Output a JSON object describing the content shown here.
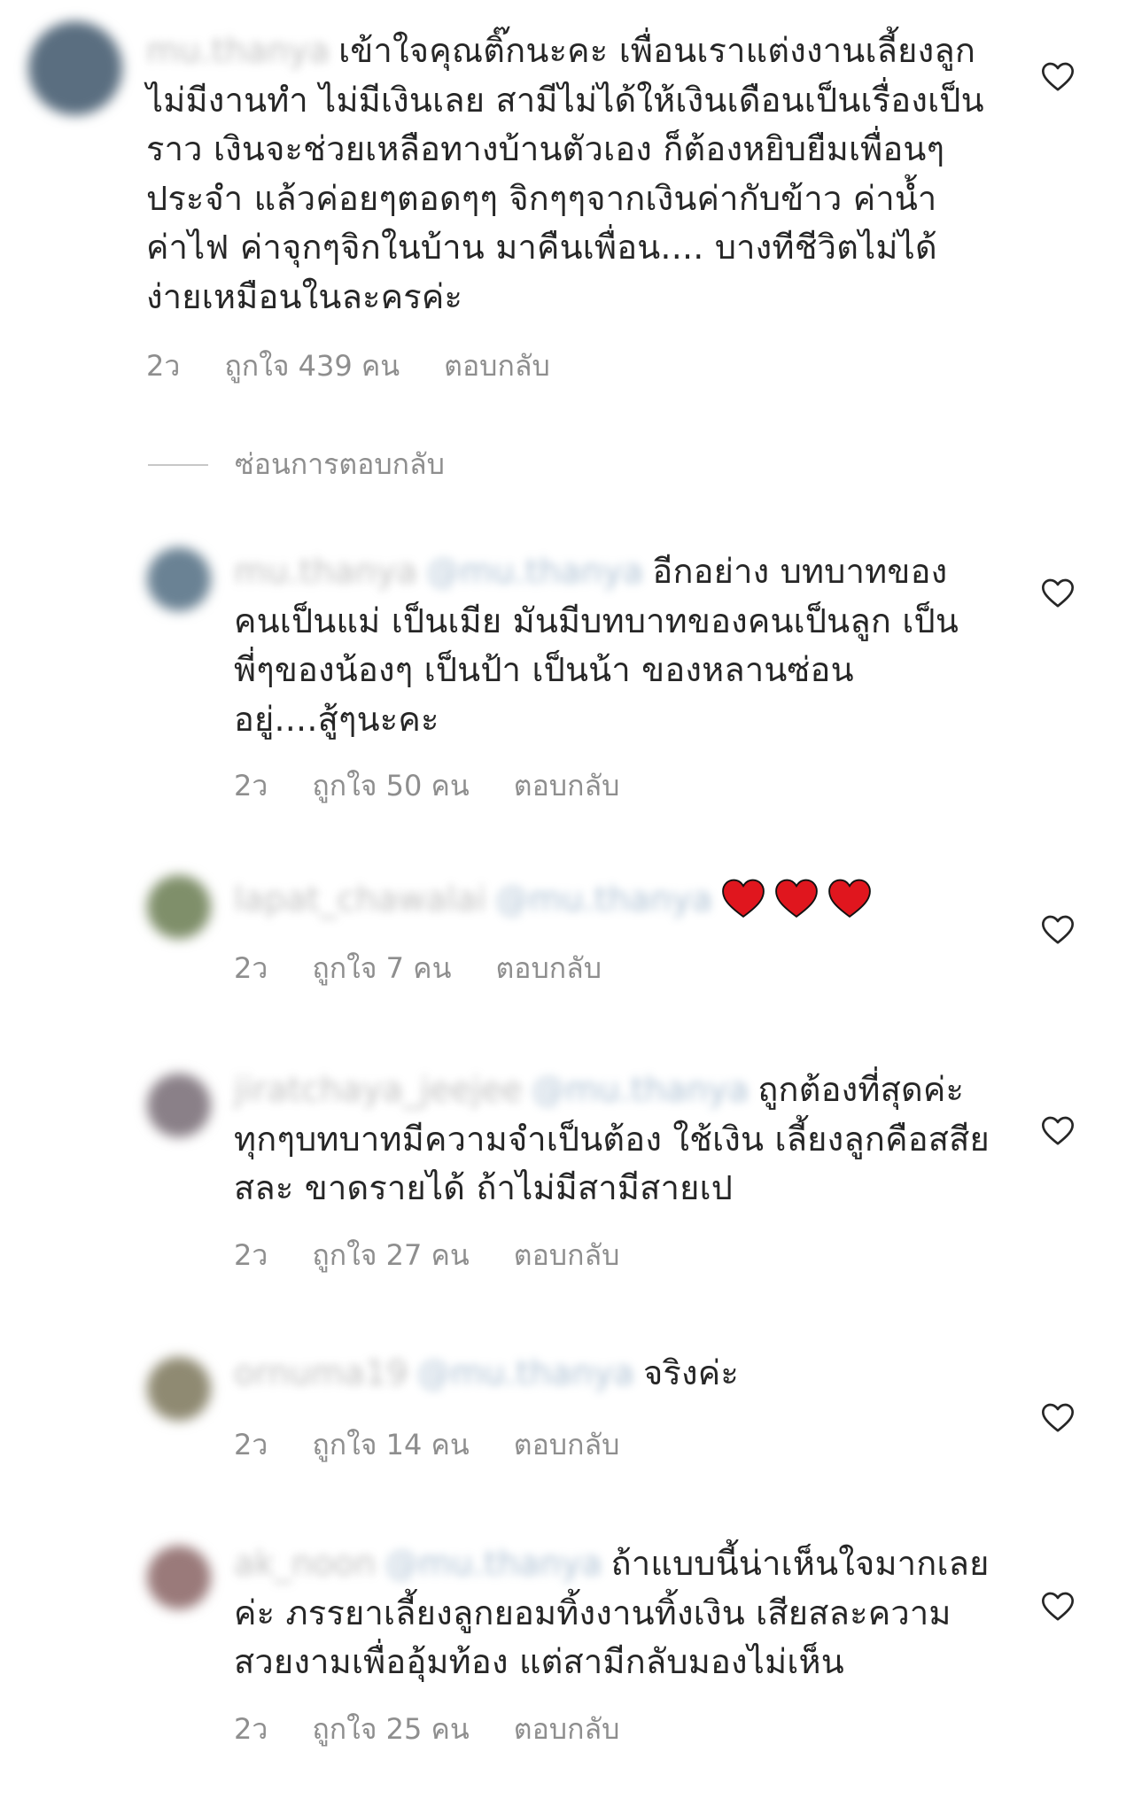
{
  "main_comment": {
    "username": "mu.thanya",
    "text": "เข้าใจคุณติ๊กนะคะ เพื่อนเราแต่งงานเลี้ยงลูก ไม่มีงานทำ ไม่มีเงินเลย สามีไม่ได้ให้เงินเดือนเป็นเรื่องเป็นราว เงินจะช่วยเหลือทางบ้านตัวเอง ก็ต้องหยิบยืมเพื่อนๆประจำ แล้วค่อยๆตอดๆๆ จิกๆๆจากเงินค่ากับข้าว ค่าน้ำ ค่าไฟ ค่าจุกๆจิกในบ้าน มาคืนเพื่อน.... บางทีชีวิตไม่ได้ง่ายเหมือนในละครค่ะ",
    "time": "2ว",
    "likes": "ถูกใจ 439 คน",
    "reply": "ตอบกลับ",
    "avatar_color": "#5a6e80"
  },
  "hide_replies_label": "ซ่อนการตอบกลับ",
  "replies": [
    {
      "username": "mu.thanya",
      "mention": "@mu.thanya",
      "text": "อีกอย่าง บทบาทของคนเป็นแม่ เป็นเมีย มันมีบทบาทของคนเป็นลูก เป็นพี่ๆของน้องๆ เป็นป้า เป็นน้า ของหลานซ่อนอยู่....สู้ๆนะคะ",
      "time": "2ว",
      "likes": "ถูกใจ 50 คน",
      "reply": "ตอบกลับ",
      "avatar_color": "#6a8294"
    },
    {
      "username": "lapat_chawalai",
      "mention": "@mu.thanya",
      "text": "",
      "emoji": "❤❤❤",
      "time": "2ว",
      "likes": "ถูกใจ 7 คน",
      "reply": "ตอบกลับ",
      "avatar_color": "#7f8f6a"
    },
    {
      "username": "jiratchaya_jeejee",
      "mention": "@mu.thanya",
      "text": "ถูกต้องที่สุดค่ะ ทุกๆบทบาทมีความจำเป็นต้อง ใช้เงิน เลี้ยงลูกคือสสียสละ ขาดรายได้ ถ้าไม่มีสามีสายเป",
      "time": "2ว",
      "likes": "ถูกใจ 27 คน",
      "reply": "ตอบกลับ",
      "avatar_color": "#8a8088"
    },
    {
      "username": "ornuma19",
      "mention": "@mu.thanya",
      "text": "จริงค่ะ",
      "time": "2ว",
      "likes": "ถูกใจ 14 คน",
      "reply": "ตอบกลับ",
      "avatar_color": "#8f8a72"
    },
    {
      "username": "ak_noon",
      "mention": "@mu.thanya",
      "text": "ถ้าแบบนี้น่าเห็นใจมากเลยค่ะ ภรรยาเลี้ยงลูกยอมทิ้งงานทิ้งเงิน เสียสละความสวยงามเพื่ออุ้มท้อง แต่สามีกลับมองไม่เห็น",
      "time": "2ว",
      "likes": "ถูกใจ 25 คน",
      "reply": "ตอบกลับ",
      "avatar_color": "#9a7a7a"
    }
  ]
}
